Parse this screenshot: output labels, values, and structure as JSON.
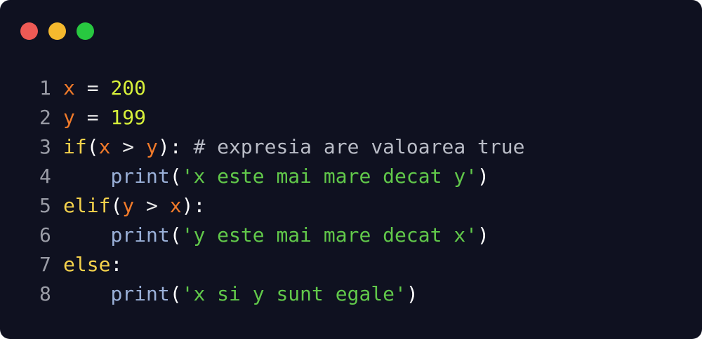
{
  "window": {
    "controls": [
      {
        "name": "close",
        "color": "#ee5a55"
      },
      {
        "name": "minimize",
        "color": "#f5b92e"
      },
      {
        "name": "maximize",
        "color": "#28c840"
      }
    ]
  },
  "colors": {
    "background": "#0f1120",
    "keyword": "#f5d24c",
    "variable": "#f07a2a",
    "number": "#d7f03a",
    "function": "#9ab0d8",
    "string": "#61c84a",
    "comment": "#b9bcc6",
    "line_number": "#9a9ca6"
  },
  "code": {
    "lines": [
      {
        "n": "1",
        "tokens": [
          {
            "t": "x",
            "k": "var"
          },
          {
            "t": " = ",
            "k": "op"
          },
          {
            "t": "200",
            "k": "num"
          }
        ]
      },
      {
        "n": "2",
        "tokens": [
          {
            "t": "y",
            "k": "var"
          },
          {
            "t": " = ",
            "k": "op"
          },
          {
            "t": "199",
            "k": "num"
          }
        ]
      },
      {
        "n": "3",
        "tokens": [
          {
            "t": "if",
            "k": "kw"
          },
          {
            "t": "(",
            "k": "punc"
          },
          {
            "t": "x",
            "k": "var"
          },
          {
            "t": " > ",
            "k": "op"
          },
          {
            "t": "y",
            "k": "var"
          },
          {
            "t": "):",
            "k": "punc"
          },
          {
            "t": " # expresia are valoarea true",
            "k": "comment"
          }
        ]
      },
      {
        "n": "4",
        "tokens": [
          {
            "t": "    ",
            "k": "op"
          },
          {
            "t": "print",
            "k": "fn"
          },
          {
            "t": "(",
            "k": "punc"
          },
          {
            "t": "'x este mai mare decat y'",
            "k": "str"
          },
          {
            "t": ")",
            "k": "punc"
          }
        ]
      },
      {
        "n": "5",
        "tokens": [
          {
            "t": "elif",
            "k": "kw"
          },
          {
            "t": "(",
            "k": "punc"
          },
          {
            "t": "y",
            "k": "var"
          },
          {
            "t": " > ",
            "k": "op"
          },
          {
            "t": "x",
            "k": "var"
          },
          {
            "t": "):",
            "k": "punc"
          }
        ]
      },
      {
        "n": "6",
        "tokens": [
          {
            "t": "    ",
            "k": "op"
          },
          {
            "t": "print",
            "k": "fn"
          },
          {
            "t": "(",
            "k": "punc"
          },
          {
            "t": "'y este mai mare decat x'",
            "k": "str"
          },
          {
            "t": ")",
            "k": "punc"
          }
        ]
      },
      {
        "n": "7",
        "tokens": [
          {
            "t": "else",
            "k": "kw"
          },
          {
            "t": ":",
            "k": "punc"
          }
        ]
      },
      {
        "n": "8",
        "tokens": [
          {
            "t": "    ",
            "k": "op"
          },
          {
            "t": "print",
            "k": "fn"
          },
          {
            "t": "(",
            "k": "punc"
          },
          {
            "t": "'x si y sunt egale'",
            "k": "str"
          },
          {
            "t": ")",
            "k": "punc"
          }
        ]
      }
    ]
  }
}
